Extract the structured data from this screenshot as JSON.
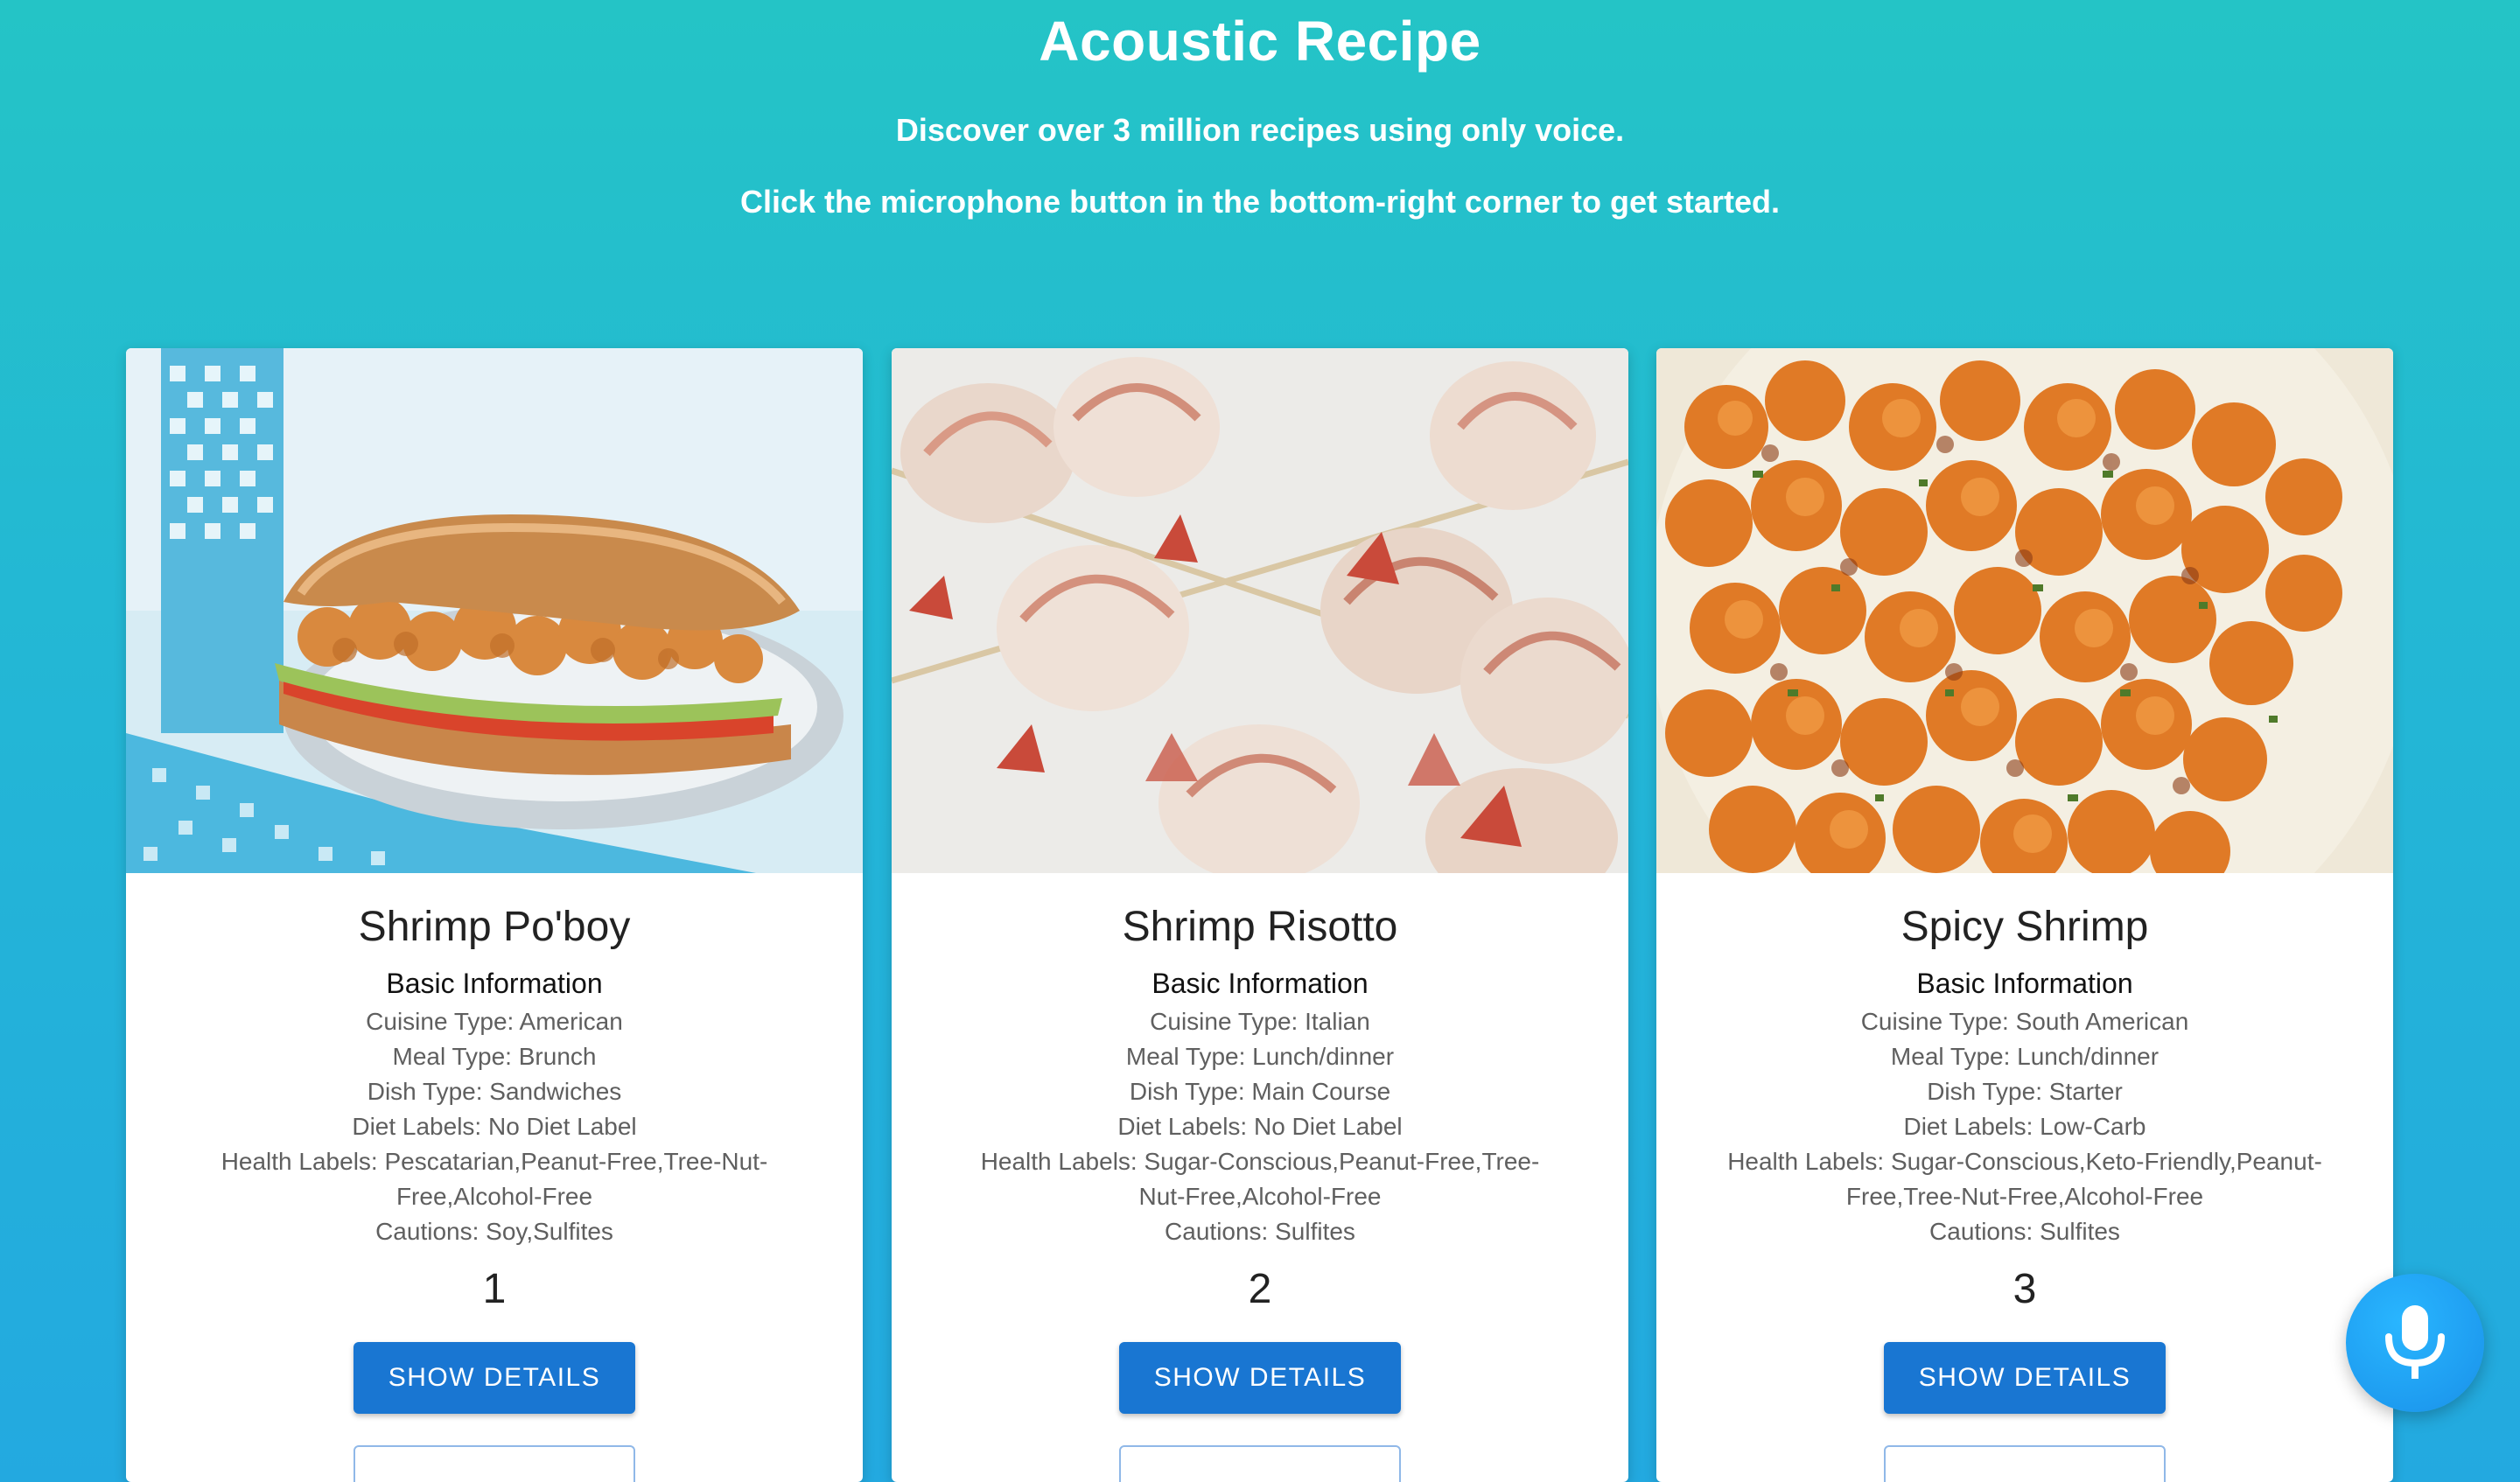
{
  "header": {
    "title": "Acoustic Recipe",
    "subtitle_1": "Discover over 3 million recipes using only voice.",
    "subtitle_2": "Click the microphone button in the bottom-right corner to get started."
  },
  "recipes": [
    {
      "title": "Shrimp Po'boy",
      "section_heading": "Basic Information",
      "cuisine": "Cuisine Type: American",
      "meal": "Meal Type: Brunch",
      "dish": "Dish Type: Sandwiches",
      "diet": "Diet Labels: No Diet Label",
      "health": "Health Labels: Pescatarian,Peanut-Free,Tree-Nut-Free,Alcohol-Free",
      "cautions": "Cautions: Soy,Sulfites",
      "number": "1",
      "button_label": "SHOW DETAILS",
      "image": "shrimp-poboy-sandwich-photo"
    },
    {
      "title": "Shrimp Risotto",
      "section_heading": "Basic Information",
      "cuisine": "Cuisine Type: Italian",
      "meal": "Meal Type: Lunch/dinner",
      "dish": "Dish Type: Main Course",
      "diet": "Diet Labels: No Diet Label",
      "health": "Health Labels: Sugar-Conscious,Peanut-Free,Tree-Nut-Free,Alcohol-Free",
      "cautions": "Cautions: Sulfites",
      "number": "2",
      "button_label": "SHOW DETAILS",
      "image": "raw-shrimp-skewers-photo"
    },
    {
      "title": "Spicy Shrimp",
      "section_heading": "Basic Information",
      "cuisine": "Cuisine Type: South American",
      "meal": "Meal Type: Lunch/dinner",
      "dish": "Dish Type: Starter",
      "diet": "Diet Labels: Low-Carb",
      "health": "Health Labels: Sugar-Conscious,Keto-Friendly,Peanut-Free,Tree-Nut-Free,Alcohol-Free",
      "cautions": "Cautions: Sulfites",
      "number": "3",
      "button_label": "SHOW DETAILS",
      "image": "spicy-shrimp-plate-photo"
    }
  ],
  "mic_button": {
    "icon": "microphone-icon"
  },
  "colors": {
    "background_top": "#24c4c6",
    "background_bottom": "#23a9e0",
    "button_primary": "#1976d2",
    "mic_button": "#1e9cf0"
  }
}
